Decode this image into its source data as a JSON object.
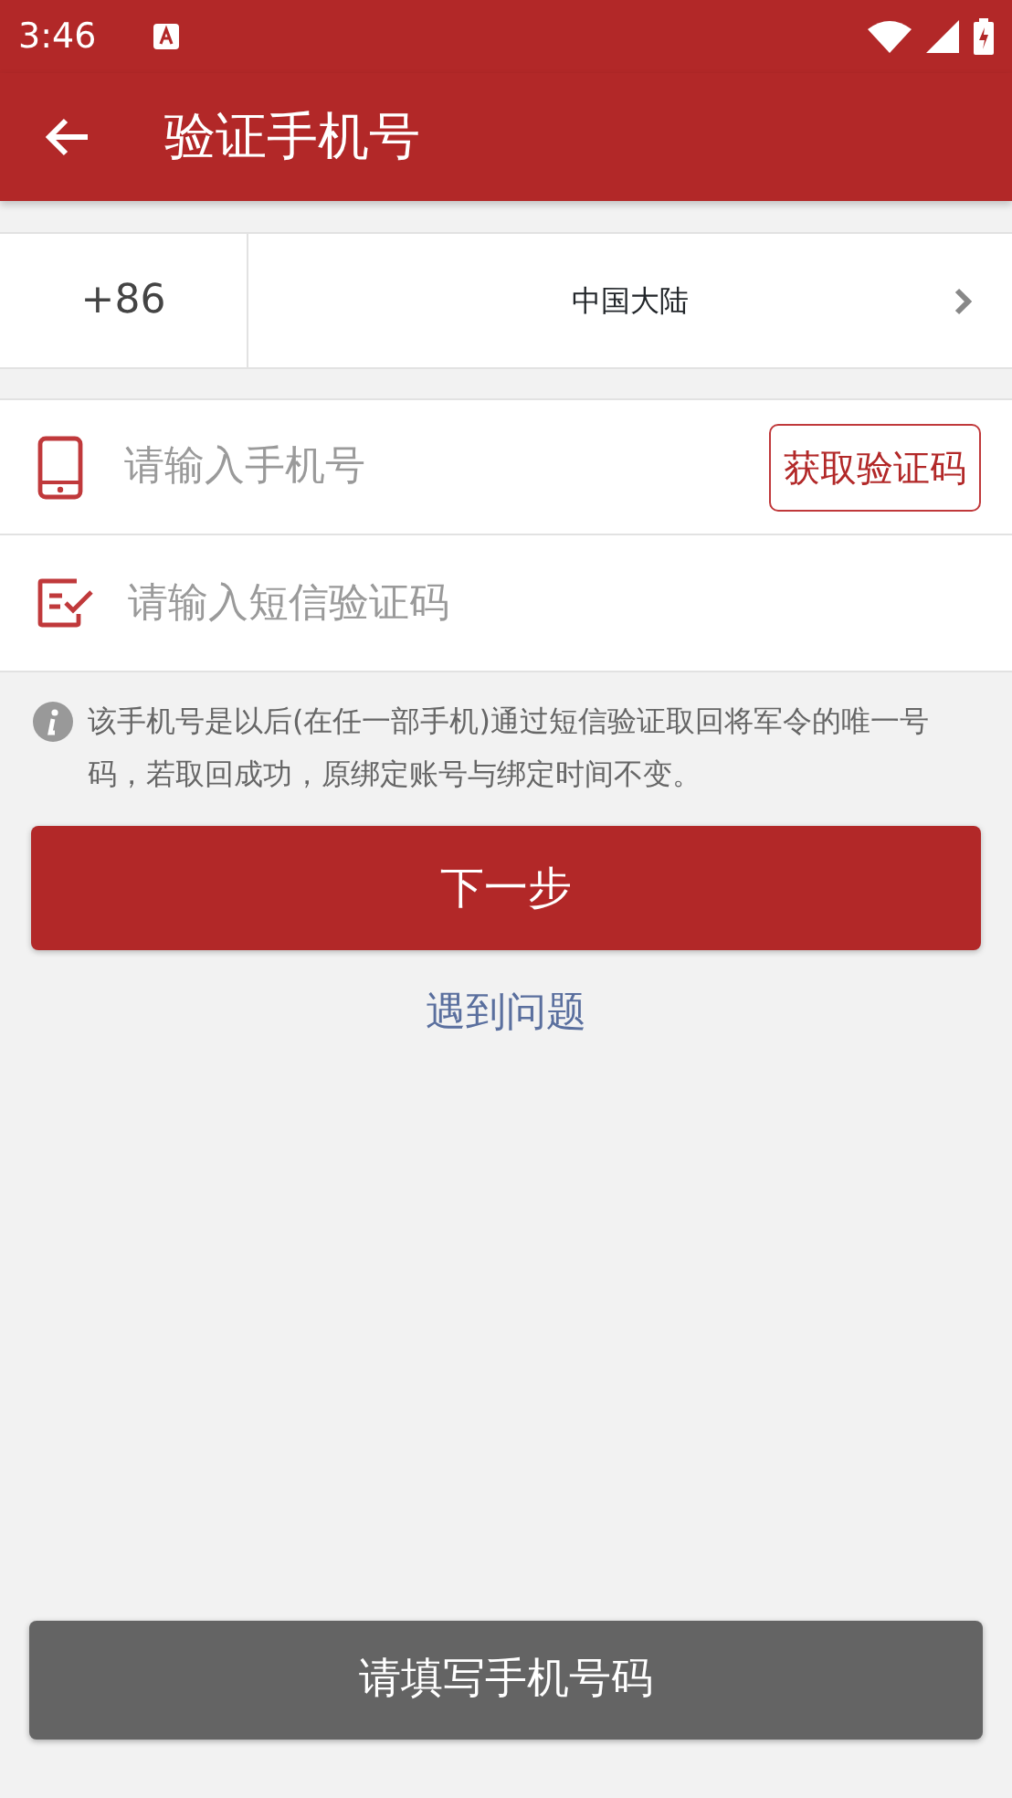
{
  "status_bar": {
    "time": "3:46"
  },
  "app_bar": {
    "title": "验证手机号"
  },
  "country": {
    "code": "+86",
    "name": "中国大陆"
  },
  "phone_field": {
    "placeholder": "请输入手机号",
    "button": "获取验证码"
  },
  "code_field": {
    "placeholder": "请输入短信验证码"
  },
  "notice": "该手机号是以后(在任一部手机)通过短信验证取回将军令的唯一号码，若取回成功，原绑定账号与绑定时间不变。",
  "next_button": {
    "label": "下一步",
    "disabled": false
  },
  "help_link": "遇到问题",
  "bottom_button": {
    "label": "请填写手机号码",
    "disabled": true
  }
}
